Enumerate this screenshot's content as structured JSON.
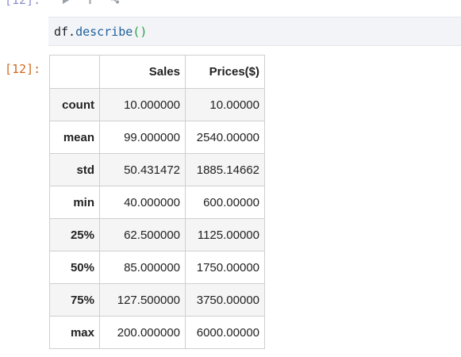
{
  "input_cell": {
    "prompt": "[12]:",
    "toolbar": {
      "icons": [
        "run-icon",
        "add-icon",
        "share-icon"
      ]
    },
    "code": {
      "object": "df.",
      "method": "describe",
      "call": "()"
    }
  },
  "output_cell": {
    "prompt": "[12]:",
    "table": {
      "columns": [
        "",
        "Sales",
        "Prices($)"
      ],
      "rows": [
        {
          "label": "count",
          "sales": "10.000000",
          "prices": "10.00000"
        },
        {
          "label": "mean",
          "sales": "99.000000",
          "prices": "2540.00000"
        },
        {
          "label": "std",
          "sales": "50.431472",
          "prices": "1885.14662"
        },
        {
          "label": "min",
          "sales": "40.000000",
          "prices": "600.00000"
        },
        {
          "label": "25%",
          "sales": "62.500000",
          "prices": "1125.00000"
        },
        {
          "label": "50%",
          "sales": "85.000000",
          "prices": "1750.00000"
        },
        {
          "label": "75%",
          "sales": "127.500000",
          "prices": "3750.00000"
        },
        {
          "label": "max",
          "sales": "200.000000",
          "prices": "6000.00000"
        }
      ]
    }
  },
  "colors": {
    "in_prompt": "#8c8fd0",
    "out_prompt": "#d2691e",
    "code_bg": "#f2f4f7",
    "method": "#1f5f9c",
    "parens": "#2f9e44",
    "row_stripe": "#f5f5f5"
  }
}
